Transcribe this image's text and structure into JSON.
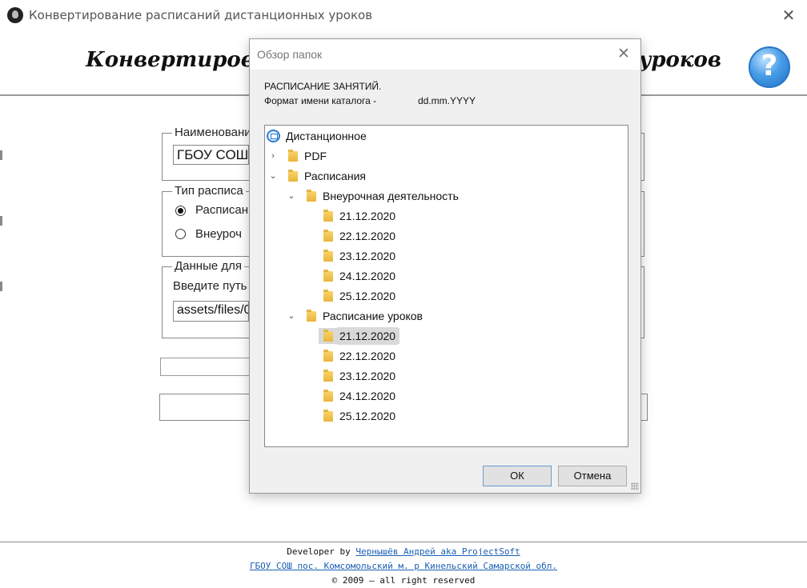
{
  "window": {
    "title": "Конвертирование расписаний дистанционных уроков",
    "heading_left": "Конвертиров",
    "heading_right": "уроков",
    "help_label": "?"
  },
  "form": {
    "group1_legend": "Наименовани",
    "school_value": "ГБОУ СОШ",
    "group2_legend": "Тип расписа",
    "radio1_label": "Расписан",
    "radio2_label": "Внеуроч",
    "group3_legend": "Данные для",
    "path_label": "Введите путь",
    "path_value": "assets/files/0"
  },
  "dialog": {
    "title": "Обзор папок",
    "desc_line1": "РАСПИСАНИЕ ЗАНЯТИЙ.",
    "desc_line2": "Формат имени каталога -",
    "desc_format": "dd.mm.YYYY",
    "tree": {
      "root": "Дистанционное",
      "pdf": "PDF",
      "schedules": "Расписания",
      "extracurricular": "Внеурочная деятельность",
      "extracurricular_dates": [
        "21.12.2020",
        "22.12.2020",
        "23.12.2020",
        "24.12.2020",
        "25.12.2020"
      ],
      "lessons": "Расписание уроков",
      "lessons_dates": [
        "21.12.2020",
        "22.12.2020",
        "23.12.2020",
        "24.12.2020",
        "25.12.2020"
      ]
    },
    "ok_label": "ОК",
    "cancel_label": "Отмена"
  },
  "footer": {
    "developer_prefix": "Developer by",
    "developer_link": "Чернышёв Андрей aka ProjectSoft",
    "school_link": "ГБОУ СОШ пос. Комсомольский м. р Кинельский Самарской обл.",
    "copyright": "© 2009 – all right reserved"
  },
  "colors": {
    "link": "#1a5fb4",
    "folder": "#f2c44f",
    "help_button": "#3d8fdf",
    "selection": "#d9d9d9"
  },
  "icons": {
    "app": "app-icon",
    "close": "close-icon",
    "help": "help-icon",
    "folder": "folder-icon",
    "computer": "computer-icon",
    "chevron_right": "chevron-right-icon",
    "chevron_down": "chevron-down-icon",
    "resize": "resize-grip-icon"
  }
}
